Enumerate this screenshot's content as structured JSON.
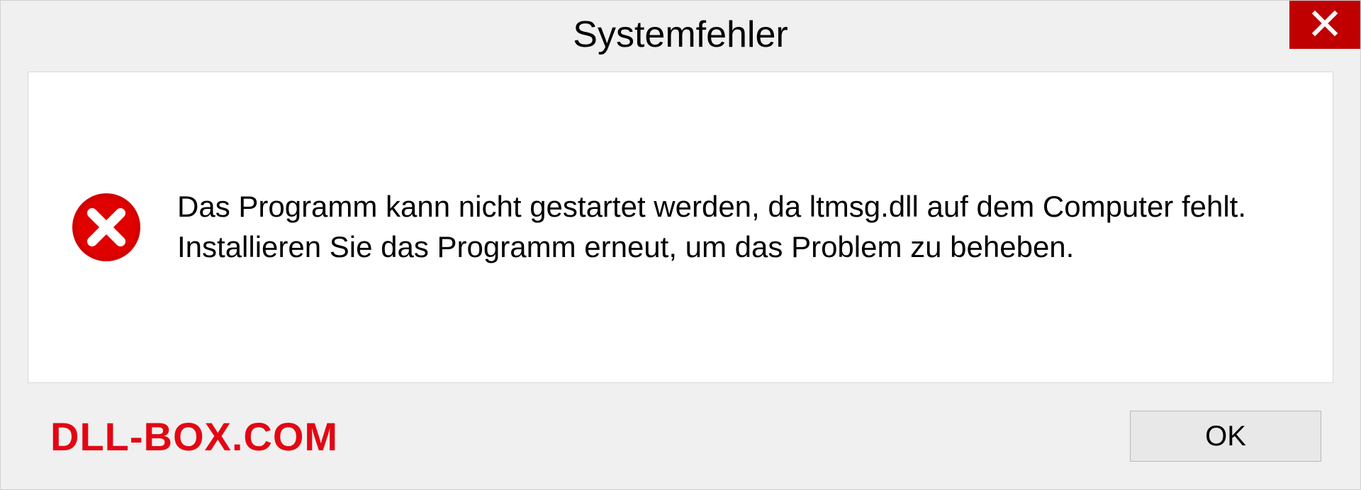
{
  "dialog": {
    "title": "Systemfehler",
    "message": "Das Programm kann nicht gestartet werden, da ltmsg.dll auf dem Computer fehlt. Installieren Sie das Programm erneut, um das Problem zu beheben.",
    "ok_label": "OK"
  },
  "watermark": "DLL-BOX.COM"
}
